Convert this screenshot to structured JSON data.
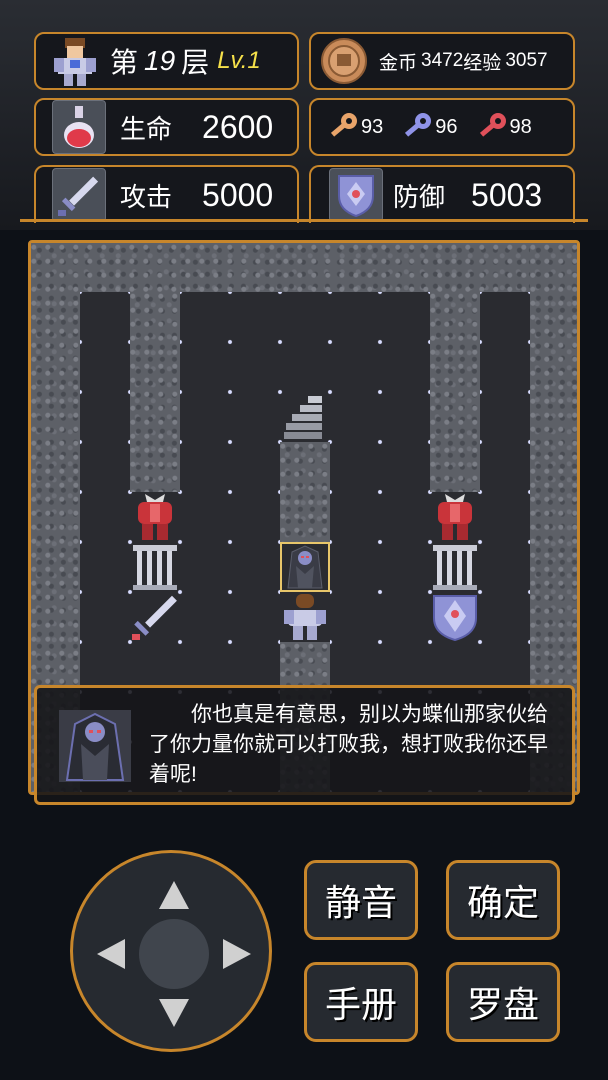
{
  "status": {
    "floor_prefix": "第",
    "floor_number": "19",
    "floor_suffix": "层",
    "level": "Lv.1",
    "gold_label": "金币",
    "gold": "3472",
    "exp_label": "经验",
    "exp": "3057",
    "hp_label": "生命",
    "hp": "2600",
    "atk_label": "攻击",
    "atk": "5000",
    "def_label": "防御",
    "def": "5003",
    "keys": [
      {
        "color": "yellow",
        "count": "93",
        "hex": "#e8a46a"
      },
      {
        "color": "blue",
        "count": "96",
        "hex": "#8f93e8"
      },
      {
        "color": "red",
        "count": "98",
        "hex": "#e0505a"
      }
    ]
  },
  "dialog": {
    "speaker_icon": "dark-cloaked-figure-icon",
    "text": "你也真是有意思，别以为蝶仙那家伙给了你力量你就可以打败我，想打败我你还早着呢!"
  },
  "controls": {
    "mute": "静音",
    "confirm": "确定",
    "manual": "手册",
    "compass": "罗盘"
  },
  "colors": {
    "accent": "#c7862b",
    "background": "#0d1117"
  }
}
